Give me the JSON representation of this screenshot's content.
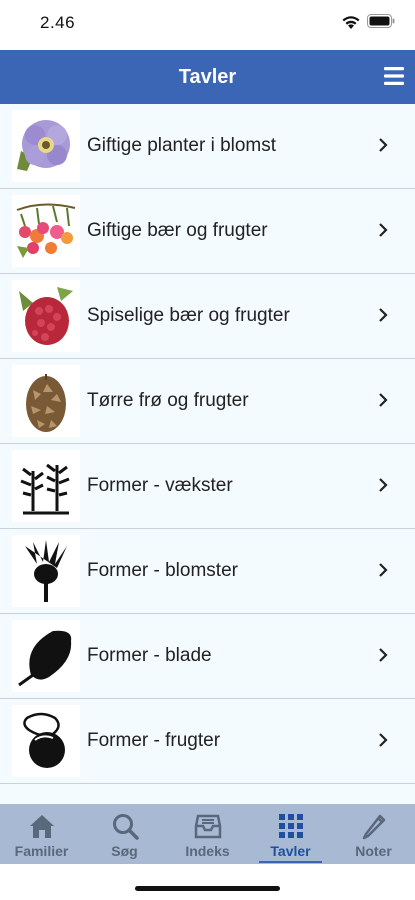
{
  "status": {
    "time": "2.46",
    "wifi_icon": "wifi-icon",
    "battery_icon": "battery-icon"
  },
  "header": {
    "title": "Tavler",
    "menu_icon": "hamburger-menu-icon",
    "background": "#3a66b5"
  },
  "list": {
    "items": [
      {
        "label": "Giftige planter i blomst",
        "icon": "purple-flower-icon"
      },
      {
        "label": "Giftige bær og frugter",
        "icon": "red-berries-icon"
      },
      {
        "label": "Spiselige bær og frugter",
        "icon": "raspberry-icon"
      },
      {
        "label": "Tørre frø og frugter",
        "icon": "pine-cone-icon"
      },
      {
        "label": "Former - vækster",
        "icon": "plant-silhouette-icon"
      },
      {
        "label": "Former - blomster",
        "icon": "flower-silhouette-icon"
      },
      {
        "label": "Former - blade",
        "icon": "leaf-silhouette-icon"
      },
      {
        "label": "Former - frugter",
        "icon": "fruit-silhouette-icon"
      }
    ]
  },
  "tabbar": {
    "tabs": [
      {
        "label": "Familier",
        "icon": "house-icon",
        "active": false
      },
      {
        "label": "Søg",
        "icon": "magnifier-icon",
        "active": false
      },
      {
        "label": "Indeks",
        "icon": "inbox-icon",
        "active": false
      },
      {
        "label": "Tavler",
        "icon": "grid-icon",
        "active": true
      },
      {
        "label": "Noter",
        "icon": "pencil-icon",
        "active": false
      }
    ],
    "active_color": "#1f4f9e",
    "inactive_color": "#59687a"
  }
}
